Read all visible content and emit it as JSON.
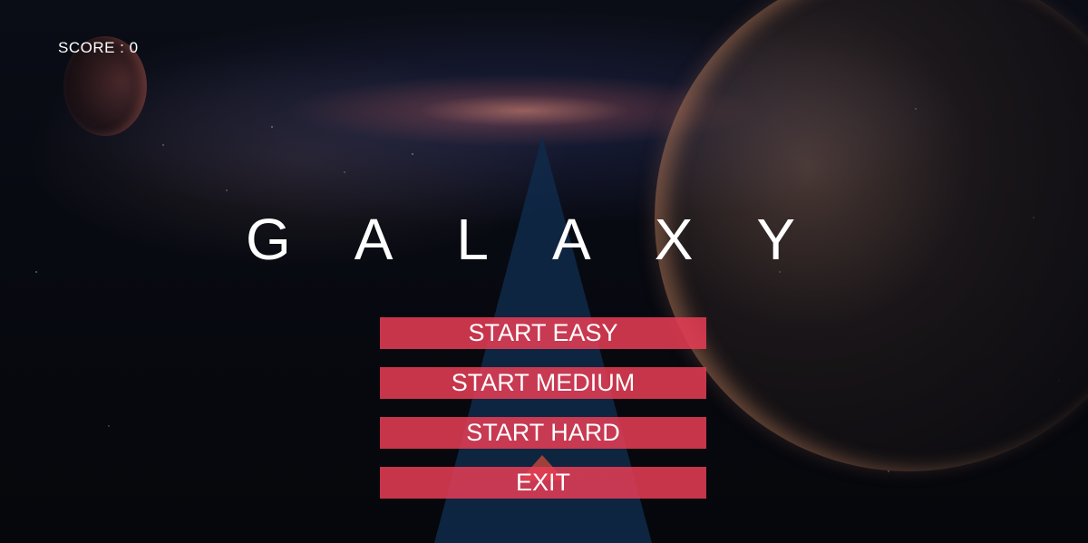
{
  "hud": {
    "score_label": "SCORE : 0"
  },
  "title": {
    "text": "GALAXY"
  },
  "menu": {
    "buttons": [
      {
        "label": "START EASY"
      },
      {
        "label": "START MEDIUM"
      },
      {
        "label": "START HARD"
      },
      {
        "label": "EXIT"
      }
    ]
  },
  "colors": {
    "button_fill": "#e63c55",
    "road_fill": "#0f2a4a",
    "ship_fill": "#b0443a",
    "text": "#ffffff"
  }
}
